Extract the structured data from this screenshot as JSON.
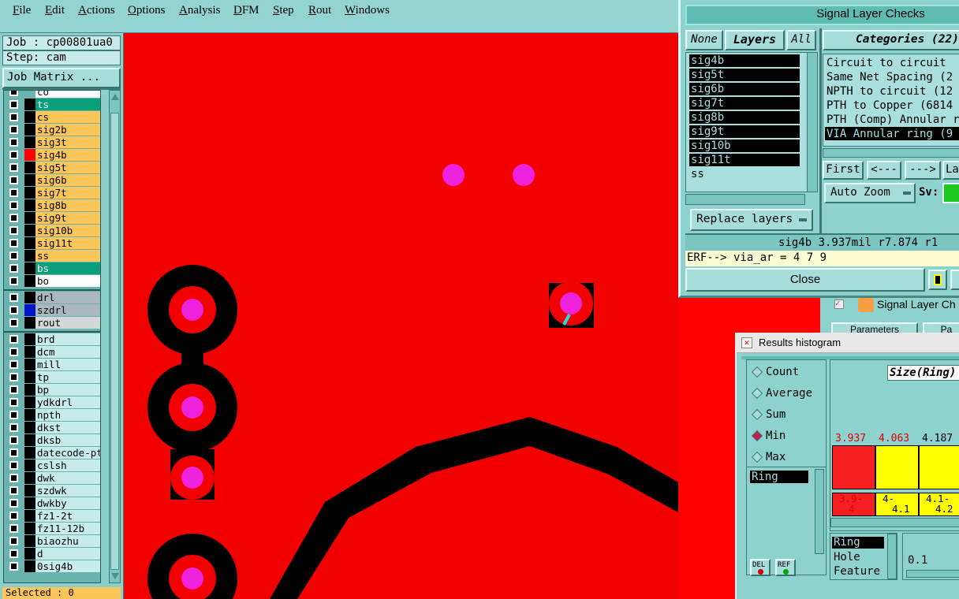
{
  "menu": {
    "items": [
      "File",
      "Edit",
      "Actions",
      "Options",
      "Analysis",
      "DFM",
      "Step",
      "Rout",
      "Windows"
    ]
  },
  "left": {
    "job": "Job : cp00801ua0",
    "step": "Step: cam",
    "job_matrix": "Job Matrix ...",
    "selected": "Selected : 0",
    "layers": [
      {
        "name": "ts",
        "color": "#0aa07c",
        "text": "#fff"
      },
      {
        "name": "cs",
        "color": "#fcc65a",
        "text": "#000"
      },
      {
        "name": "sig2b",
        "color": "#fcc65a",
        "text": "#000"
      },
      {
        "name": "sig3t",
        "color": "#fcc65a",
        "text": "#000"
      },
      {
        "name": "sig4b",
        "color": "#fcc65a",
        "text": "#000",
        "marker": "#f00"
      },
      {
        "name": "sig5t",
        "color": "#fcc65a",
        "text": "#000"
      },
      {
        "name": "sig6b",
        "color": "#fcc65a",
        "text": "#000"
      },
      {
        "name": "sig7t",
        "color": "#fcc65a",
        "text": "#000"
      },
      {
        "name": "sig8b",
        "color": "#fcc65a",
        "text": "#000"
      },
      {
        "name": "sig9t",
        "color": "#fcc65a",
        "text": "#000"
      },
      {
        "name": "sig10b",
        "color": "#fcc65a",
        "text": "#000"
      },
      {
        "name": "sig11t",
        "color": "#fcc65a",
        "text": "#000"
      },
      {
        "name": "ss",
        "color": "#fcc65a",
        "text": "#000"
      },
      {
        "name": "bs",
        "color": "#0aa07c",
        "text": "#fff"
      },
      {
        "name": "bo",
        "color": "#ffffff",
        "text": "#000"
      }
    ],
    "drill_layers": [
      {
        "name": "drl",
        "color": "#a8b8be"
      },
      {
        "name": "szdrl",
        "color": "#a8b8be",
        "marker": "#0014c8"
      },
      {
        "name": "rout",
        "color": "#d4d8d8"
      }
    ],
    "doc_layers": [
      "brd",
      "dcm",
      "mill",
      "tp",
      "bp",
      "ydkdrl",
      "npth",
      "dkst",
      "dksb",
      "datecode-ptc",
      "cslsh",
      "dwk",
      "szdwk",
      "dwkby",
      "fz1-2t",
      "fz11-12b",
      "biaozhu",
      "d",
      "0sig4b"
    ]
  },
  "signal_checks": {
    "title": "Signal Layer Checks",
    "none": "None",
    "layers": "Layers",
    "all": "All",
    "layer_items": [
      "sig4b",
      "sig5t",
      "sig6b",
      "sig7t",
      "sig8b",
      "sig9t",
      "sig10b",
      "sig11t",
      "ss"
    ],
    "categories_title": "Categories (22)",
    "categories": [
      "Circuit to circuit",
      "Same Net Spacing (2",
      "NPTH to circuit (12",
      "PTH to Copper (6814",
      "PTH (Comp) Annular r",
      "VIA Annular ring (9"
    ],
    "first": "First",
    "prev": "<---",
    "next": "--->",
    "last": "La",
    "auto_zoom": "Auto Zoom",
    "sv": "Sv:",
    "replace_layers": "Replace layers",
    "status": "sig4b 3.937mil   r7.874  r1",
    "erf": "ERF--> via_ar = 4 7 9",
    "close": "Close"
  },
  "behind": {
    "signal_layer": "Signal Layer Ch",
    "parameters": "Parameters",
    "pa": "Pa"
  },
  "histogram": {
    "title": "Results histogram",
    "options": [
      {
        "label": "Count",
        "selected": false
      },
      {
        "label": "Average",
        "selected": false
      },
      {
        "label": "Sum",
        "selected": false
      },
      {
        "label": "Min",
        "selected": true
      },
      {
        "label": "Max",
        "selected": false
      }
    ],
    "size_label": "Size(Ring)",
    "list_items": [
      "Ring"
    ],
    "del": "DEL",
    "ref": "REF",
    "bars": [
      {
        "value": "3.937",
        "color": "#f62020",
        "vcolor": "#e00000",
        "range1": "3.9-",
        "range2": "4"
      },
      {
        "value": "4.063",
        "color": "#ffff00",
        "vcolor": "#e00000",
        "range1": "4-",
        "range2": "4.1"
      },
      {
        "value": "4.187",
        "color": "#ffff00",
        "vcolor": "#000",
        "range1": "4.1-",
        "range2": "4.2"
      }
    ],
    "attr_items": [
      "Ring",
      "Hole",
      "Feature"
    ],
    "step_value": "0.1"
  }
}
